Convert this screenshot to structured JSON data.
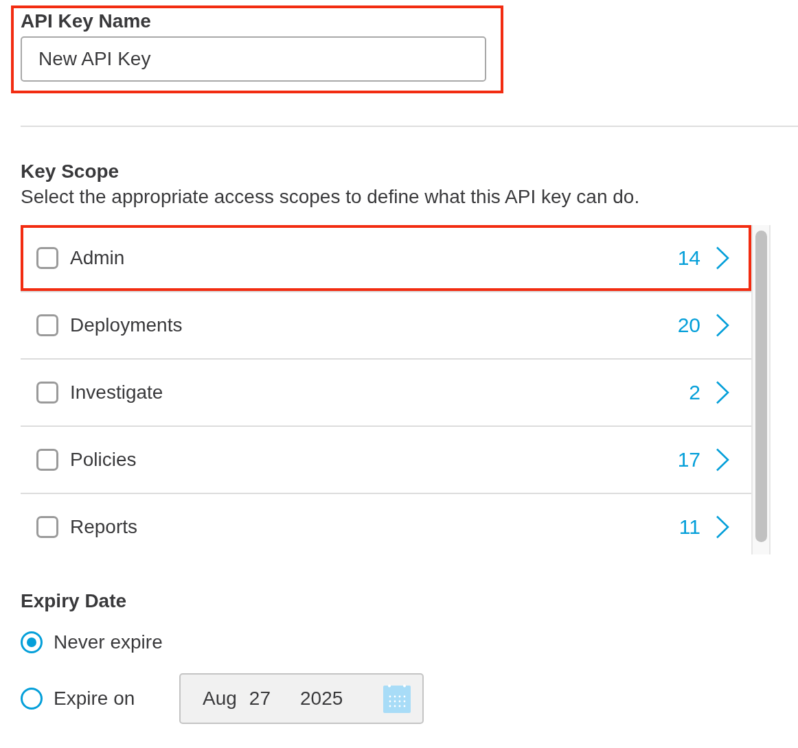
{
  "api_key_name": {
    "label": "API Key Name",
    "value": "New API Key",
    "highlighted": true
  },
  "key_scope": {
    "title": "Key Scope",
    "description": "Select the appropriate access scopes to define what this API key can do.",
    "items": [
      {
        "label": "Admin",
        "count": "14",
        "checked": false,
        "highlighted": true
      },
      {
        "label": "Deployments",
        "count": "20",
        "checked": false,
        "highlighted": false
      },
      {
        "label": "Investigate",
        "count": "2",
        "checked": false,
        "highlighted": false
      },
      {
        "label": "Policies",
        "count": "17",
        "checked": false,
        "highlighted": false
      },
      {
        "label": "Reports",
        "count": "11",
        "checked": false,
        "highlighted": false
      }
    ]
  },
  "expiry_date": {
    "title": "Expiry Date",
    "options": [
      {
        "label": "Never expire",
        "selected": true
      },
      {
        "label": "Expire on",
        "selected": false,
        "date": {
          "month": "Aug",
          "day": "27",
          "year": "2025",
          "disabled": true
        }
      }
    ]
  }
}
